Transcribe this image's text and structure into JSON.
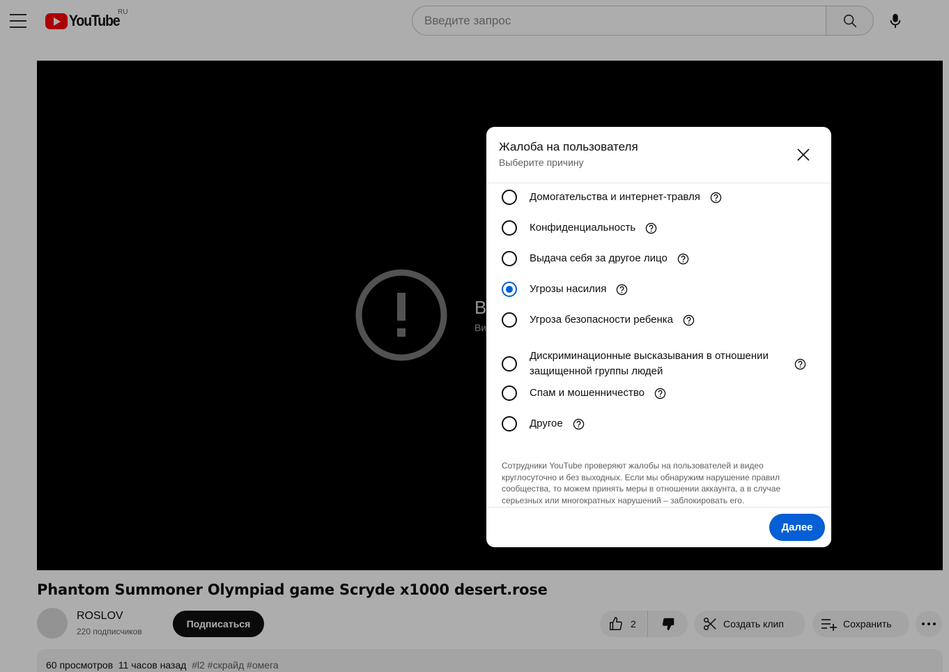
{
  "header": {
    "logo_text": "YouTube",
    "logo_country": "RU",
    "search_placeholder": "Введите запрос"
  },
  "player": {
    "error_text_visible": "В",
    "error_subtext_visible": "Ви"
  },
  "video": {
    "title": "Phantom Summoner Olympiad game Scryde x1000 desert.rose",
    "channel_name": "ROSLOV",
    "subscribers": "220 подписчиков",
    "subscribe_label": "Подписаться",
    "like_count": "2",
    "clip_label": "Создать клип",
    "save_label": "Сохранить",
    "views": "60 просмотров",
    "posted": "11 часов назад",
    "tags": "#l2 #скрайд #омега"
  },
  "dialog": {
    "title": "Жалоба на пользователя",
    "subtitle": "Выберите причину",
    "reasons": [
      {
        "label": "Домогательства и интернет-травля",
        "checked": false
      },
      {
        "label": "Конфиденциальность",
        "checked": false
      },
      {
        "label": "Выдача себя за другое лицо",
        "checked": false
      },
      {
        "label": "Угрозы насилия",
        "checked": true
      },
      {
        "label": "Угроза безопасности ребенка",
        "checked": false
      },
      {
        "label": "Дискриминационные высказывания в отношении защищенной группы людей",
        "checked": false
      },
      {
        "label": "Спам и мошенничество",
        "checked": false
      },
      {
        "label": "Другое",
        "checked": false
      }
    ],
    "note": "Сотрудники YouTube проверяют жалобы на пользователей и видео круглосуточно и без выходных. Если мы обнаружим нарушение правил сообщества, то можем принять меры в отношении аккаунта, а в случае серьезных или многократных нарушений – заблокировать его.",
    "next_label": "Далее"
  },
  "colors": {
    "accent": "#065fd4",
    "brand": "#ff0000"
  }
}
